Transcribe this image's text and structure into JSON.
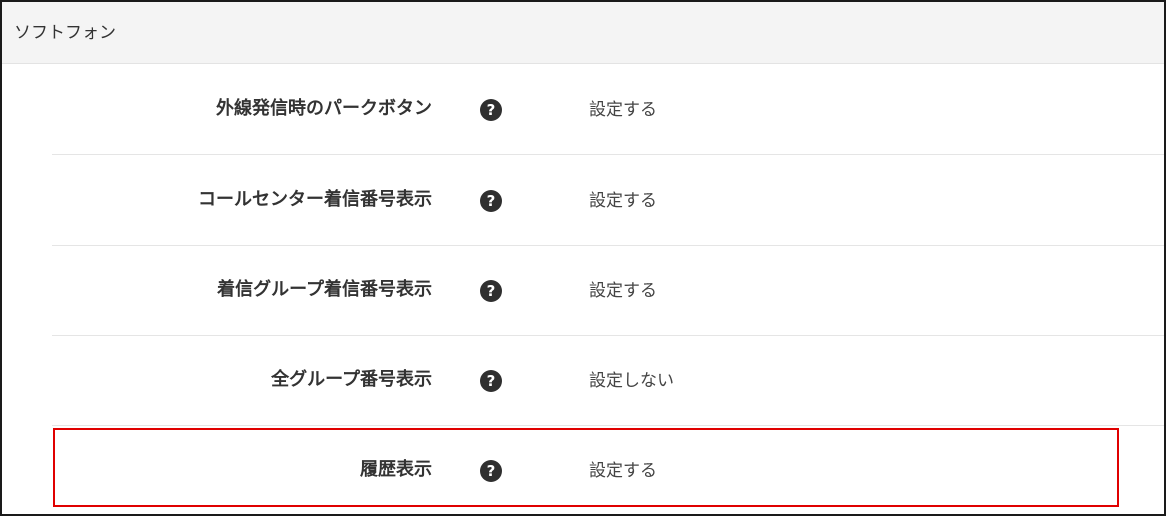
{
  "section": {
    "title": "ソフトフォン"
  },
  "rows": [
    {
      "label": "外線発信時のパークボタン",
      "value": "設定する"
    },
    {
      "label": "コールセンター着信番号表示",
      "value": "設定する"
    },
    {
      "label": "着信グループ着信番号表示",
      "value": "設定する"
    },
    {
      "label": "全グループ番号表示",
      "value": "設定しない"
    },
    {
      "label": "履歴表示",
      "value": "設定する"
    }
  ],
  "icons": {
    "help": {
      "name": "question-circle-icon",
      "glyph": "?"
    }
  },
  "colors": {
    "header_bg": "#f4f4f4",
    "highlight_border": "#e00000",
    "icon_bg": "#2f2f2f",
    "text": "#333333"
  }
}
